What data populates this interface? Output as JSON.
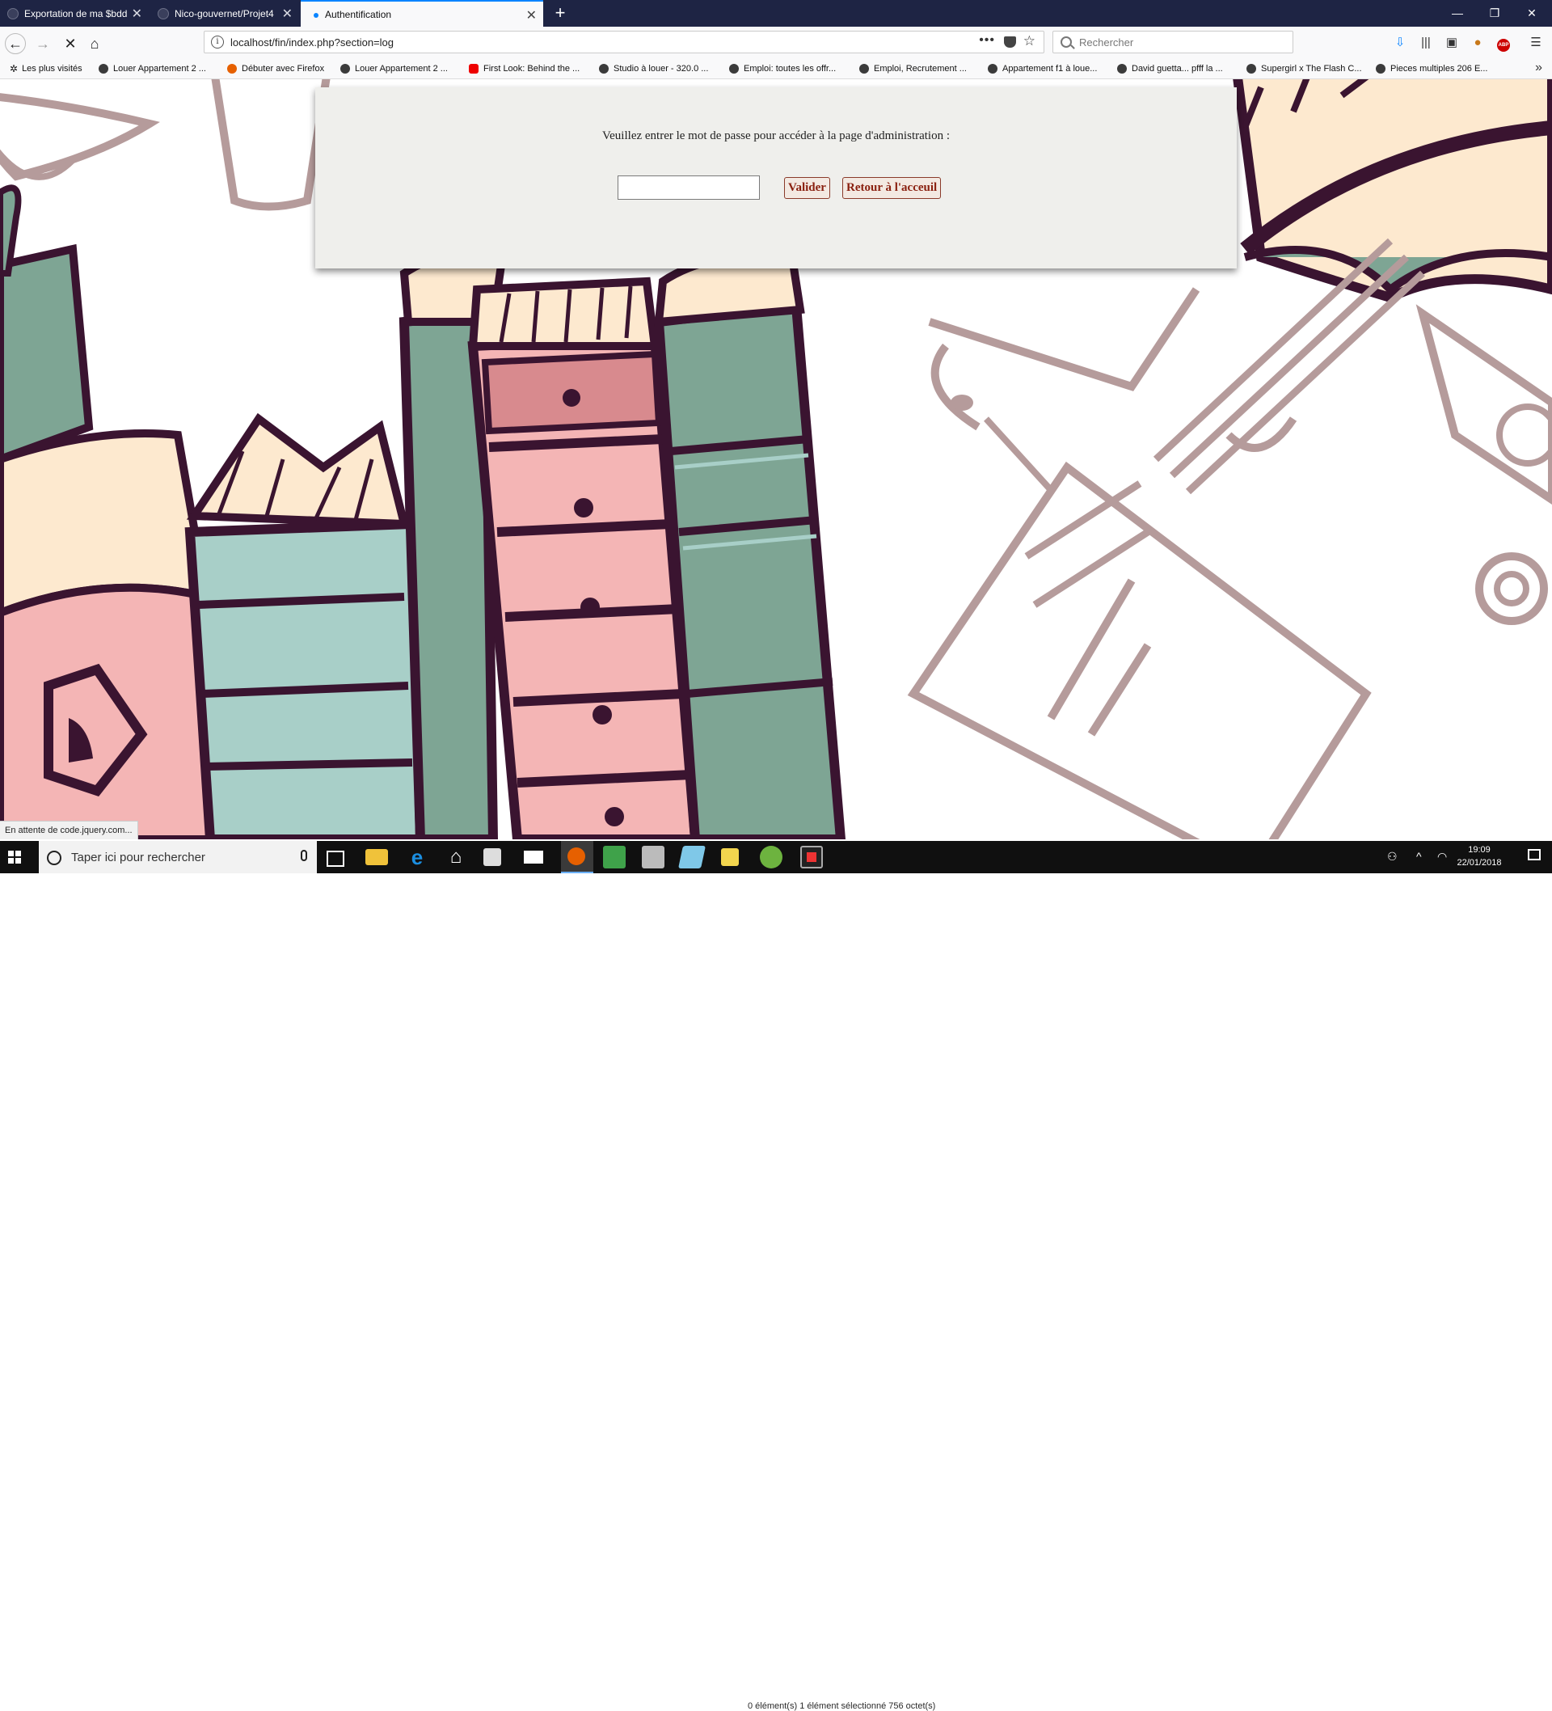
{
  "browser": {
    "tabs": [
      {
        "label": "Exportation de ma $bdd blog.s",
        "active": false
      },
      {
        "label": "Nico-gouvernet/Projet4",
        "active": false
      },
      {
        "label": "Authentification",
        "active": true
      }
    ],
    "url": "localhost/fin/index.php?section=log",
    "search_placeholder": "Rechercher",
    "bookmarks": [
      "Les plus visités",
      "Louer Appartement 2 ...",
      "Débuter avec Firefox",
      "Louer Appartement 2 ...",
      "First Look: Behind the ...",
      "Studio à louer - 320.0 ...",
      "Emploi: toutes les offr...",
      "Emploi, Recrutement ...",
      "Appartement f1 à loue...",
      "David guetta... pfff la ...",
      "Supergirl x The Flash C...",
      "Pieces multiples 206 E..."
    ],
    "status_text": "En attente de code.jquery.com..."
  },
  "page": {
    "prompt": "Veuillez entrer le mot de passe pour accéder à la page d'administration :",
    "password_value": "",
    "submit_label": "Valider",
    "home_label": "Retour à l'acceuil"
  },
  "taskbar": {
    "search_placeholder": "Taper ici pour rechercher",
    "time": "19:09",
    "date": "22/01/2018",
    "ghost_text": "0 élément(s)   1 élément sélectionné  756 octet(s)"
  },
  "colors": {
    "tabbar": "#1e2444",
    "accent": "#0a84ff",
    "button_text": "#8a2010",
    "panel": "#efefec",
    "illustration_dark": "#3a1430",
    "illustration_green": "#7ea594",
    "illustration_pink": "#f4b5b5",
    "illustration_taupe": "#b59b9b",
    "illustration_cream": "#fde9cf"
  }
}
